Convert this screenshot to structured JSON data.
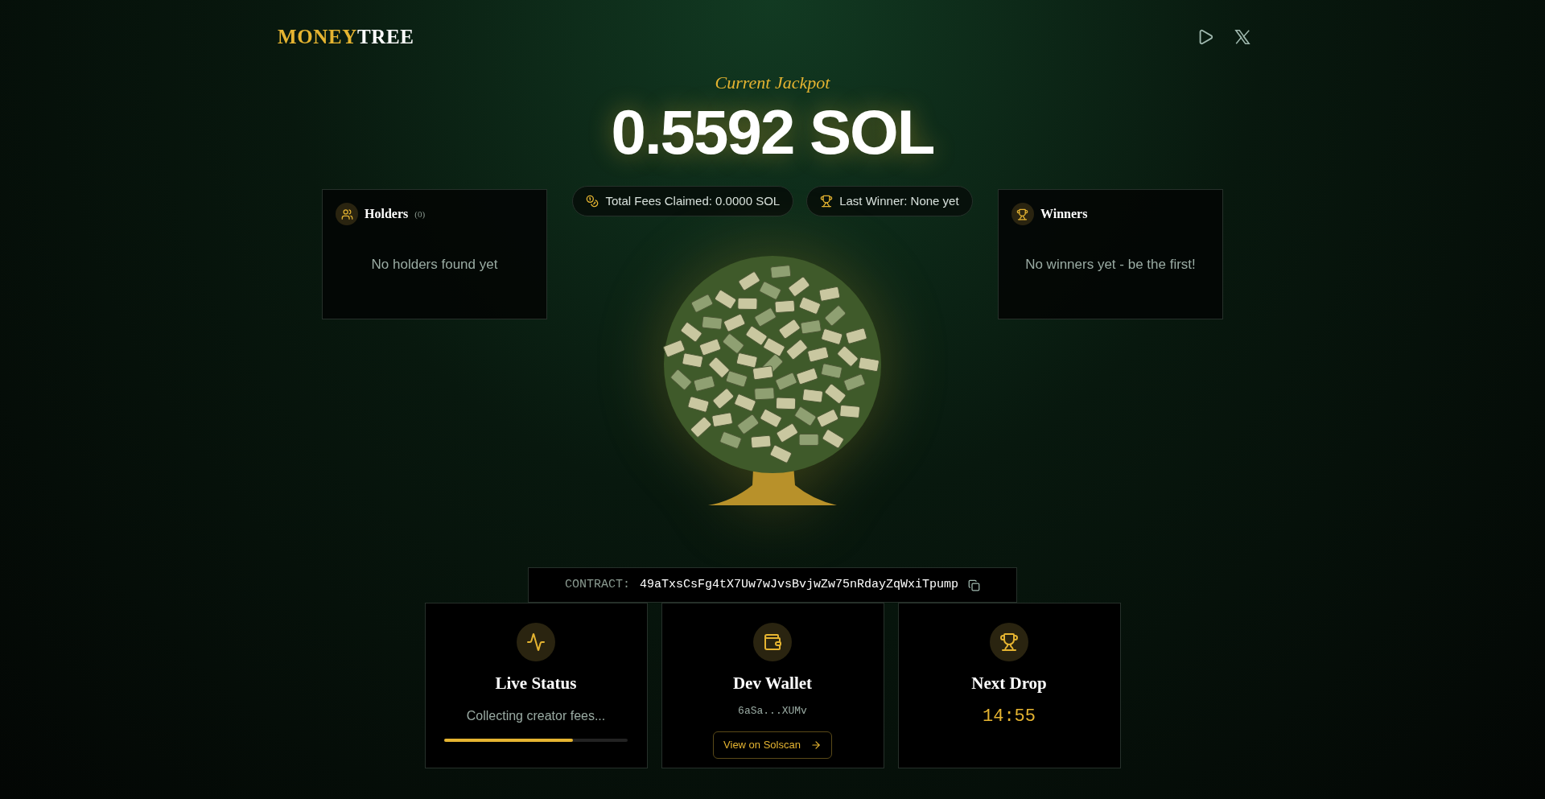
{
  "header": {
    "logo": {
      "part1": "MONEY",
      "part2": "TREE"
    }
  },
  "jackpot": {
    "label": "Current Jackpot",
    "amount": "0.5592 SOL"
  },
  "pills": [
    {
      "kind": "coins",
      "text": "Total Fees Claimed: 0.0000 SOL"
    },
    {
      "kind": "trophy",
      "text": "Last Winner: None yet"
    }
  ],
  "holders": {
    "title": "Holders",
    "count": "(0)",
    "empty": "No holders found yet"
  },
  "winners": {
    "title": "Winners",
    "empty": "No winners yet - be the first!"
  },
  "contract": {
    "label": "CONTRACT:",
    "address": "49aTxsCsFg4tX7Uw7wJvsBvjwZw75nRdayZqWxiTpump"
  },
  "cards": [
    {
      "kind": "status",
      "title": "Live Status",
      "text": "Collecting creator fees...",
      "level": 0.7
    },
    {
      "kind": "wallet",
      "title": "Dev Wallet",
      "address": "6aSa...XUMv",
      "link": "View on Solscan"
    },
    {
      "kind": "drop",
      "title": "Next Drop",
      "timer": "14:55"
    }
  ]
}
